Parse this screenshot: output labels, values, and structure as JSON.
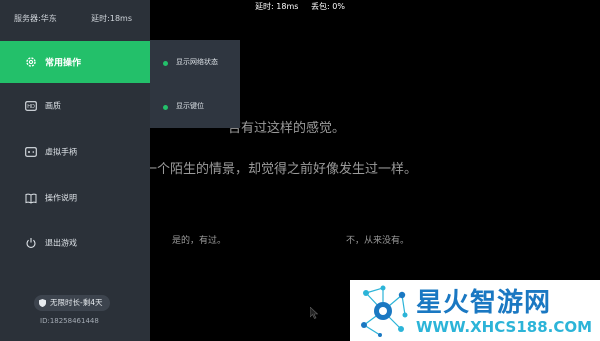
{
  "status_bar": {
    "latency": "延时: 18ms",
    "packet_loss": "丢包: 0%"
  },
  "sidebar": {
    "server": "服务器:华东",
    "latency": "延时:18ms",
    "items": [
      {
        "label": "常用操作",
        "icon": "gear-icon",
        "active": true
      },
      {
        "label": "画质",
        "icon": "hd-icon"
      },
      {
        "label": "虚拟手柄",
        "icon": "gamepad-icon"
      },
      {
        "label": "操作说明",
        "icon": "book-icon"
      },
      {
        "label": "退出游戏",
        "icon": "power-icon"
      }
    ],
    "badge": "无限时长-剩4天",
    "user_id": "ID:18258461448"
  },
  "submenu": {
    "items": [
      {
        "label": "显示网络状态"
      },
      {
        "label": "显示键位"
      }
    ]
  },
  "game": {
    "line1": "否有过这样的感觉。",
    "line2": "一个陌生的情景，却觉得之前好像发生过一样。",
    "choice_yes": "是的，有过。",
    "choice_no": "不，从来没有。"
  },
  "watermark": {
    "title": "星火智游网",
    "url": "WWW.XHCS188.COM"
  },
  "colors": {
    "accent": "#23c06a",
    "sidebar_bg": "#2b3139",
    "watermark_blue": "#1a78c2"
  }
}
